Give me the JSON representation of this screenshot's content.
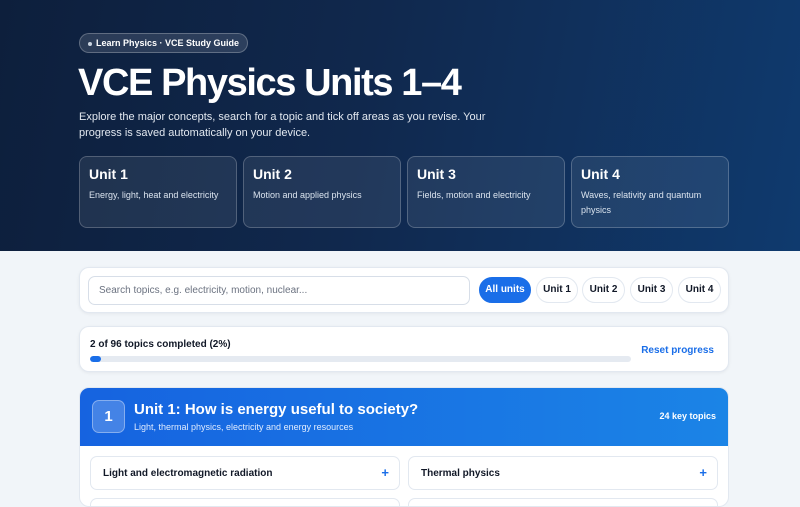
{
  "hero": {
    "pill": "Learn Physics · VCE Study Guide",
    "title": "VCE Physics Units 1–4",
    "description": "Explore the major concepts, search for a topic and tick off areas as you revise. Your progress is saved automatically on your device.",
    "units": [
      {
        "title": "Unit 1",
        "desc": "Energy, light, heat and electricity"
      },
      {
        "title": "Unit 2",
        "desc": "Motion and applied physics"
      },
      {
        "title": "Unit 3",
        "desc": "Fields, motion and electricity"
      },
      {
        "title": "Unit 4",
        "desc": "Waves, relativity and quantum physics"
      }
    ]
  },
  "search": {
    "placeholder": "Search topics, e.g. electricity, motion, nuclear...",
    "value": "",
    "filters": [
      "All units",
      "Unit 1",
      "Unit 2",
      "Unit 3",
      "Unit 4"
    ],
    "active_filter": "All units"
  },
  "progress": {
    "text": "2 of 96 topics completed (2%)",
    "fraction": 0.02,
    "reset_label": "Reset progress"
  },
  "unit_section": {
    "number": "1",
    "title": "Unit 1: How is energy useful to society?",
    "subtitle": "Light, thermal physics, electricity and energy resources",
    "count": "24 key topics",
    "topics": [
      {
        "label": "Light and electromagnetic radiation",
        "toggle": "+"
      },
      {
        "label": "Thermal physics",
        "toggle": "+"
      }
    ]
  },
  "colors": {
    "accent": "#1a6ee8",
    "hero_bg": "#0d1f3c"
  }
}
